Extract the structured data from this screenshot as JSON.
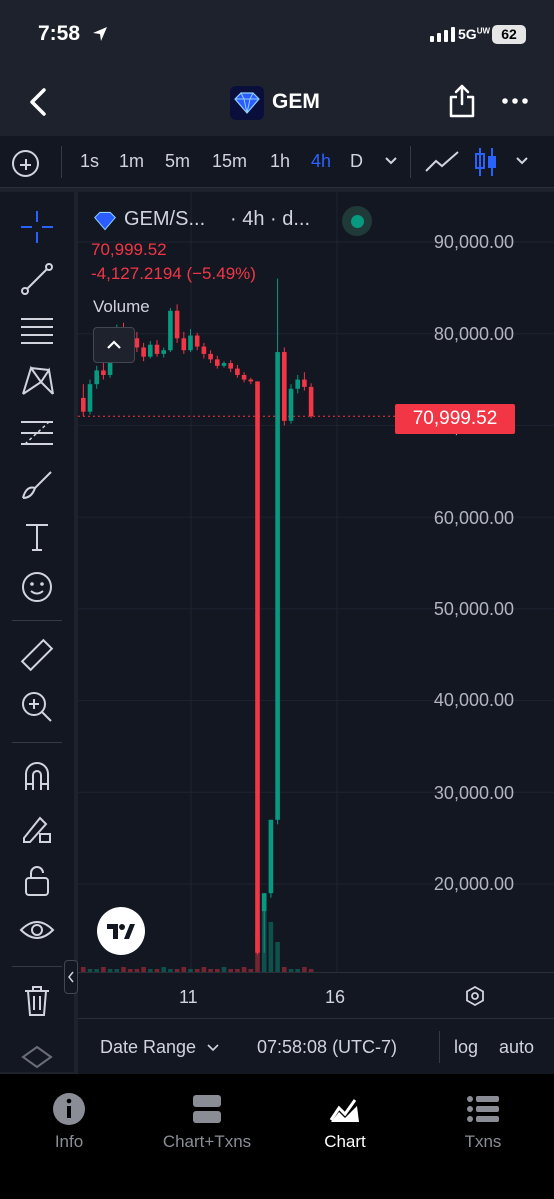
{
  "status": {
    "time": "7:58",
    "network": "5G",
    "network_sup": "UW",
    "battery": "62"
  },
  "header": {
    "title": "GEM"
  },
  "timeframes": [
    "1s",
    "1m",
    "5m",
    "15m",
    "1h",
    "4h",
    "D"
  ],
  "active_timeframe": "4h",
  "legend": {
    "symbol": "GEM/S...",
    "interval": "· 4h · d...",
    "price": "70,999.52",
    "change": "-4,127.2194 (−5.49%)",
    "volume_label": "Volume"
  },
  "price_axis": [
    "90,000.00",
    "80,000.00",
    "70,000.00",
    "60,000.00",
    "50,000.00",
    "40,000.00",
    "30,000.00",
    "20,000.00"
  ],
  "current_price": "70,999.52",
  "time_axis": [
    "11",
    "16"
  ],
  "range_bar": {
    "date_range": "Date Range",
    "clock": "07:58:08 (UTC-7)",
    "log": "log",
    "auto": "auto"
  },
  "tabs": [
    {
      "label": "Info",
      "icon": "info-icon"
    },
    {
      "label": "Chart+Txns",
      "icon": "split-view-icon"
    },
    {
      "label": "Chart",
      "icon": "chart-icon",
      "active": true
    },
    {
      "label": "Txns",
      "icon": "list-icon"
    }
  ],
  "colors": {
    "up": "#089981",
    "down": "#f23645",
    "accent": "#2962ff",
    "background": "#131722"
  },
  "chart_data": {
    "type": "candlestick",
    "ylim": [
      10000,
      92000
    ],
    "x_ticks": [
      "11",
      "16"
    ],
    "candles": [
      {
        "o": 73000,
        "h": 74500,
        "c": 71500,
        "l": 71000
      },
      {
        "o": 71500,
        "h": 75000,
        "c": 74500,
        "l": 71200
      },
      {
        "o": 74500,
        "h": 76500,
        "c": 76000,
        "l": 74000
      },
      {
        "o": 76000,
        "h": 76800,
        "c": 75500,
        "l": 75000
      },
      {
        "o": 75500,
        "h": 79000,
        "c": 79000,
        "l": 75200
      },
      {
        "o": 79000,
        "h": 81000,
        "c": 80500,
        "l": 78500
      },
      {
        "o": 80500,
        "h": 81200,
        "c": 80000,
        "l": 79500
      },
      {
        "o": 80000,
        "h": 80600,
        "c": 79500,
        "l": 79000
      },
      {
        "o": 79500,
        "h": 80200,
        "c": 78500,
        "l": 78000
      },
      {
        "o": 78500,
        "h": 79000,
        "c": 77500,
        "l": 77000
      },
      {
        "o": 77500,
        "h": 79200,
        "c": 78800,
        "l": 77300
      },
      {
        "o": 78800,
        "h": 79300,
        "c": 77800,
        "l": 77500
      },
      {
        "o": 77800,
        "h": 78500,
        "c": 78200,
        "l": 77400
      },
      {
        "o": 78200,
        "h": 82800,
        "c": 82500,
        "l": 78000
      },
      {
        "o": 82500,
        "h": 83200,
        "c": 79500,
        "l": 79000
      },
      {
        "o": 79500,
        "h": 80200,
        "c": 78200,
        "l": 77800
      },
      {
        "o": 78200,
        "h": 80500,
        "c": 79800,
        "l": 78000
      },
      {
        "o": 79800,
        "h": 80100,
        "c": 78600,
        "l": 78200
      },
      {
        "o": 78600,
        "h": 79000,
        "c": 77800,
        "l": 77300
      },
      {
        "o": 77800,
        "h": 78200,
        "c": 77200,
        "l": 76800
      },
      {
        "o": 77200,
        "h": 77600,
        "c": 76500,
        "l": 76200
      },
      {
        "o": 76500,
        "h": 77000,
        "c": 76800,
        "l": 76300
      },
      {
        "o": 76800,
        "h": 77100,
        "c": 76200,
        "l": 75800
      },
      {
        "o": 76200,
        "h": 76600,
        "c": 75500,
        "l": 75200
      },
      {
        "o": 75500,
        "h": 75800,
        "c": 75000,
        "l": 74700
      },
      {
        "o": 75000,
        "h": 75200,
        "c": 74800,
        "l": 74500
      },
      {
        "o": 74800,
        "h": 74800,
        "c": 12500,
        "l": 12300
      },
      {
        "o": 17000,
        "h": 19000,
        "c": 19000,
        "l": 12500
      },
      {
        "o": 19000,
        "h": 27000,
        "c": 27000,
        "l": 18500
      },
      {
        "o": 27000,
        "h": 86000,
        "c": 78000,
        "l": 26500
      },
      {
        "o": 78000,
        "h": 78500,
        "c": 70500,
        "l": 70000
      },
      {
        "o": 70500,
        "h": 74500,
        "c": 74000,
        "l": 70200
      },
      {
        "o": 74000,
        "h": 75500,
        "c": 75000,
        "l": 73500
      },
      {
        "o": 75000,
        "h": 75800,
        "c": 74200,
        "l": 73800
      },
      {
        "o": 74200,
        "h": 74600,
        "c": 70999.52,
        "l": 70800
      }
    ]
  }
}
